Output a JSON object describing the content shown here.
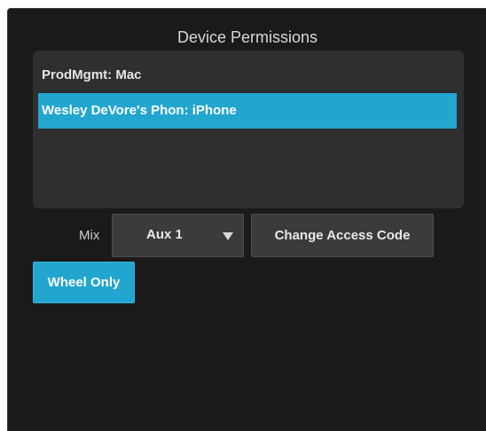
{
  "panel": {
    "title": "Device Permissions"
  },
  "devices": [
    {
      "label": "ProdMgmt: Mac",
      "selected": false
    },
    {
      "label": "Wesley DeVore's Phon: iPhone",
      "selected": true
    }
  ],
  "mix": {
    "label": "Mix",
    "selected_value": "Aux 1",
    "chevron_icon": "chevron-down-icon"
  },
  "buttons": {
    "change_access_code": "Change Access Code",
    "wheel_only": "Wheel Only",
    "wheel_only_active": true
  },
  "colors": {
    "accent": "#22a6d0",
    "background": "#1a1a1a",
    "list_background": "#2f2f2f",
    "button_background": "#3b3b3b"
  }
}
